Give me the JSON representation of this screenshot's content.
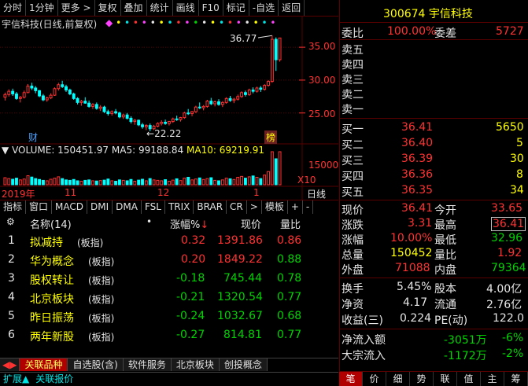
{
  "toolbar": {
    "items": [
      "分时",
      "1分钟",
      "更多 >",
      "复权",
      "叠加",
      "统计",
      "画线",
      "F10",
      "标记",
      "-自选",
      "返回"
    ]
  },
  "chart": {
    "title": "宇信科技(日线,前复权)",
    "title_color": "#d8d8d8",
    "price_axis": [
      "35.00",
      "30.00",
      "25.00"
    ],
    "high_label": "36.77",
    "low_label": "22.22",
    "event_label_cai": "财",
    "event_label_bang": "榜",
    "volume_line": {
      "label": "VOLUME: 150451.97",
      "ma5": "MA5: 99188.84",
      "ma10": "MA10: 69219.91"
    },
    "volume_axis": [
      "15000",
      "X10"
    ],
    "date_labels": [
      "2019年",
      "11",
      "12",
      "1"
    ],
    "period_label": "日线",
    "candles": [
      [
        27.4,
        28.1,
        26.9,
        27.8
      ],
      [
        27.8,
        28.6,
        27.5,
        28.3
      ],
      [
        28.3,
        28.7,
        27.6,
        27.9
      ],
      [
        27.9,
        28.2,
        27.0,
        27.2
      ],
      [
        27.2,
        27.6,
        26.6,
        27.4
      ],
      [
        27.4,
        28.4,
        27.2,
        28.1
      ],
      [
        28.1,
        29.4,
        28.0,
        29.1
      ],
      [
        29.1,
        29.6,
        28.5,
        28.8
      ],
      [
        28.8,
        29.1,
        28.0,
        28.4
      ],
      [
        28.4,
        28.5,
        27.4,
        27.6
      ],
      [
        27.6,
        27.9,
        26.8,
        27.0
      ],
      [
        27.0,
        27.5,
        26.7,
        27.3
      ],
      [
        27.3,
        28.0,
        27.1,
        27.7
      ],
      [
        27.7,
        28.9,
        27.6,
        28.7
      ],
      [
        28.7,
        29.6,
        28.4,
        29.3
      ],
      [
        29.3,
        29.9,
        28.8,
        29.0
      ],
      [
        29.0,
        29.3,
        28.2,
        28.5
      ],
      [
        28.5,
        28.7,
        27.7,
        27.9
      ],
      [
        27.9,
        28.1,
        27.0,
        27.2
      ],
      [
        27.2,
        27.4,
        26.3,
        26.6
      ],
      [
        26.6,
        27.0,
        26.1,
        26.8
      ],
      [
        26.8,
        27.4,
        26.4,
        26.5
      ],
      [
        26.5,
        26.9,
        25.8,
        26.0
      ],
      [
        26.0,
        26.5,
        25.6,
        26.3
      ],
      [
        26.3,
        26.6,
        25.5,
        25.7
      ],
      [
        25.7,
        26.2,
        25.3,
        25.9
      ],
      [
        25.9,
        26.1,
        25.0,
        25.2
      ],
      [
        25.2,
        25.5,
        24.6,
        24.9
      ],
      [
        24.9,
        25.4,
        24.6,
        25.2
      ],
      [
        25.2,
        25.6,
        24.8,
        25.0
      ],
      [
        25.0,
        25.2,
        24.2,
        24.4
      ],
      [
        24.4,
        24.9,
        24.1,
        24.7
      ],
      [
        24.7,
        25.0,
        24.0,
        24.2
      ],
      [
        24.2,
        24.5,
        23.4,
        23.7
      ],
      [
        23.7,
        24.1,
        23.2,
        23.9
      ],
      [
        23.9,
        24.0,
        23.0,
        23.2
      ],
      [
        23.2,
        23.5,
        22.6,
        22.9
      ],
      [
        22.9,
        23.3,
        22.4,
        23.1
      ],
      [
        23.1,
        23.4,
        22.22,
        22.6
      ],
      [
        22.6,
        23.2,
        22.4,
        23.0
      ],
      [
        23.0,
        23.6,
        22.8,
        23.4
      ],
      [
        23.4,
        23.9,
        23.1,
        23.6
      ],
      [
        23.6,
        24.0,
        23.2,
        23.4
      ],
      [
        23.4,
        23.8,
        23.1,
        23.7
      ],
      [
        23.7,
        24.3,
        23.5,
        24.1
      ],
      [
        24.1,
        24.6,
        23.8,
        24.0
      ],
      [
        24.0,
        24.4,
        23.7,
        24.3
      ],
      [
        24.3,
        25.2,
        24.1,
        25.0
      ],
      [
        25.0,
        25.6,
        24.7,
        24.9
      ],
      [
        24.9,
        25.3,
        24.5,
        25.2
      ],
      [
        25.2,
        26.1,
        25.0,
        25.9
      ],
      [
        25.9,
        26.6,
        25.6,
        25.8
      ],
      [
        25.8,
        26.2,
        25.4,
        26.0
      ],
      [
        26.0,
        27.0,
        25.8,
        26.8
      ],
      [
        26.8,
        27.3,
        26.2,
        26.4
      ],
      [
        26.4,
        26.9,
        26.0,
        26.7
      ],
      [
        26.7,
        27.1,
        26.1,
        26.3
      ],
      [
        26.3,
        26.8,
        25.9,
        26.6
      ],
      [
        26.6,
        27.4,
        26.4,
        27.2
      ],
      [
        27.2,
        27.6,
        26.7,
        26.9
      ],
      [
        26.9,
        27.3,
        26.5,
        27.1
      ],
      [
        27.1,
        27.8,
        26.9,
        27.5
      ],
      [
        27.5,
        28.3,
        27.3,
        28.1
      ],
      [
        28.1,
        28.4,
        27.5,
        27.8
      ],
      [
        27.8,
        28.7,
        27.6,
        28.5
      ],
      [
        28.5,
        28.9,
        28.0,
        28.3
      ],
      [
        28.3,
        29.0,
        28.1,
        28.8
      ],
      [
        28.8,
        29.1,
        28.2,
        28.6
      ],
      [
        28.6,
        29.4,
        28.4,
        29.2
      ],
      [
        29.2,
        30.0,
        29.0,
        29.8
      ],
      [
        29.8,
        36.77,
        29.6,
        36.2
      ],
      [
        36.2,
        36.5,
        31.4,
        33.1
      ],
      [
        33.1,
        36.41,
        32.8,
        36.41
      ]
    ],
    "volumes": [
      32,
      28,
      25,
      30,
      22,
      26,
      41,
      35,
      28,
      24,
      20,
      18,
      25,
      30,
      36,
      28,
      22,
      20,
      24,
      18,
      16,
      20,
      22,
      18,
      17,
      19,
      21,
      26,
      18,
      16,
      22,
      20,
      18,
      24,
      16,
      21,
      25,
      18,
      28,
      22,
      20,
      18,
      23,
      16,
      21,
      27,
      19,
      30,
      34,
      22,
      26,
      31,
      24,
      28,
      32,
      20,
      18,
      22,
      30,
      27,
      24,
      34,
      38,
      30,
      36,
      40,
      34,
      28,
      44,
      60,
      150,
      118,
      150
    ]
  },
  "indicator_tabs": [
    "指标",
    "窗口",
    "MACD",
    "DMI",
    "DMA",
    "FSL",
    "TRIX",
    "BRAR",
    "CR",
    ">",
    "模板",
    "+",
    "-"
  ],
  "list": {
    "headers": {
      "name": "名称(14)",
      "dot": "•",
      "change": "涨幅%",
      "price": "现价",
      "ratio": "量比"
    },
    "rows": [
      {
        "idx": "1",
        "name": "拟减持",
        "tag": "(板指)",
        "change": "0.32",
        "price": "1391.86",
        "ratio": "0.86"
      },
      {
        "idx": "2",
        "name": "华为概念",
        "tag": "(板指)",
        "change": "0.20",
        "price": "1849.22",
        "ratio": "0.88"
      },
      {
        "idx": "3",
        "name": "股权转让",
        "tag": "(板指)",
        "change": "-0.18",
        "price": "745.44",
        "ratio": "0.78"
      },
      {
        "idx": "4",
        "name": "北京板块",
        "tag": "(板指)",
        "change": "-0.21",
        "price": "1320.54",
        "ratio": "0.77"
      },
      {
        "idx": "5",
        "name": "昨日振荡",
        "tag": "(板指)",
        "change": "-0.24",
        "price": "1032.67",
        "ratio": "0.68"
      },
      {
        "idx": "6",
        "name": "两年新股",
        "tag": "(板指)",
        "change": "-0.27",
        "price": "814.81",
        "ratio": "0.77"
      }
    ]
  },
  "bottom_tabs": [
    "关联品种",
    "自选股(含)",
    "软件服务",
    "北京板块",
    "创投概念"
  ],
  "status_bar": [
    "扩展",
    "关联报价"
  ],
  "quote": {
    "code": "300674",
    "name": "宇信科技",
    "weibi_label": "委比",
    "weibi": "100.00%",
    "weicha_label": "委差",
    "weicha": "5727",
    "sell": [
      {
        "label": "卖五",
        "price": "",
        "vol": ""
      },
      {
        "label": "卖四",
        "price": "",
        "vol": ""
      },
      {
        "label": "卖三",
        "price": "",
        "vol": ""
      },
      {
        "label": "卖二",
        "price": "",
        "vol": ""
      },
      {
        "label": "卖一",
        "price": "",
        "vol": ""
      }
    ],
    "buy": [
      {
        "label": "买一",
        "price": "36.41",
        "vol": "5650"
      },
      {
        "label": "买二",
        "price": "36.40",
        "vol": "5"
      },
      {
        "label": "买三",
        "price": "36.39",
        "vol": "30"
      },
      {
        "label": "买四",
        "price": "36.36",
        "vol": "8"
      },
      {
        "label": "买五",
        "price": "36.35",
        "vol": "34"
      }
    ],
    "stats": [
      {
        "l1": "现价",
        "v1": "36.41",
        "c1": "red",
        "l2": "今开",
        "v2": "33.65",
        "c2": "red"
      },
      {
        "l1": "涨跌",
        "v1": "3.31",
        "c1": "red",
        "l2": "最高",
        "v2": "36.41",
        "c2": "red"
      },
      {
        "l1": "涨幅",
        "v1": "10.00%",
        "c1": "red",
        "l2": "最低",
        "v2": "32.96",
        "c2": "green"
      },
      {
        "l1": "总量",
        "v1": "150452",
        "c1": "yellow",
        "l2": "量比",
        "v2": "1.92",
        "c2": "red"
      },
      {
        "l1": "外盘",
        "v1": "71088",
        "c1": "red",
        "l2": "内盘",
        "v2": "79364",
        "c2": "green"
      }
    ],
    "fund": [
      {
        "l1": "换手",
        "v1": "5.45%",
        "l2": "股本",
        "v2": "4.00亿"
      },
      {
        "l1": "净资",
        "v1": "4.17",
        "l2": "流通",
        "v2": "2.76亿"
      },
      {
        "l1": "收益(三)",
        "v1": "0.224",
        "l2": "PE(动)",
        "v2": "122.0"
      }
    ],
    "flow": [
      {
        "label": "净流入额",
        "value": "-3051万",
        "pct": "-6%"
      },
      {
        "label": "大宗流入",
        "value": "-1172万",
        "pct": "-2%"
      }
    ]
  },
  "right_tabs": [
    "笔",
    "价",
    "细",
    "势",
    "联",
    "值",
    "主",
    "筹"
  ],
  "colors": {
    "up": "#ff3232",
    "down": "#00d200",
    "border": "#5a0000",
    "ma5": "#ffffff",
    "ma10": "#ffff00"
  }
}
